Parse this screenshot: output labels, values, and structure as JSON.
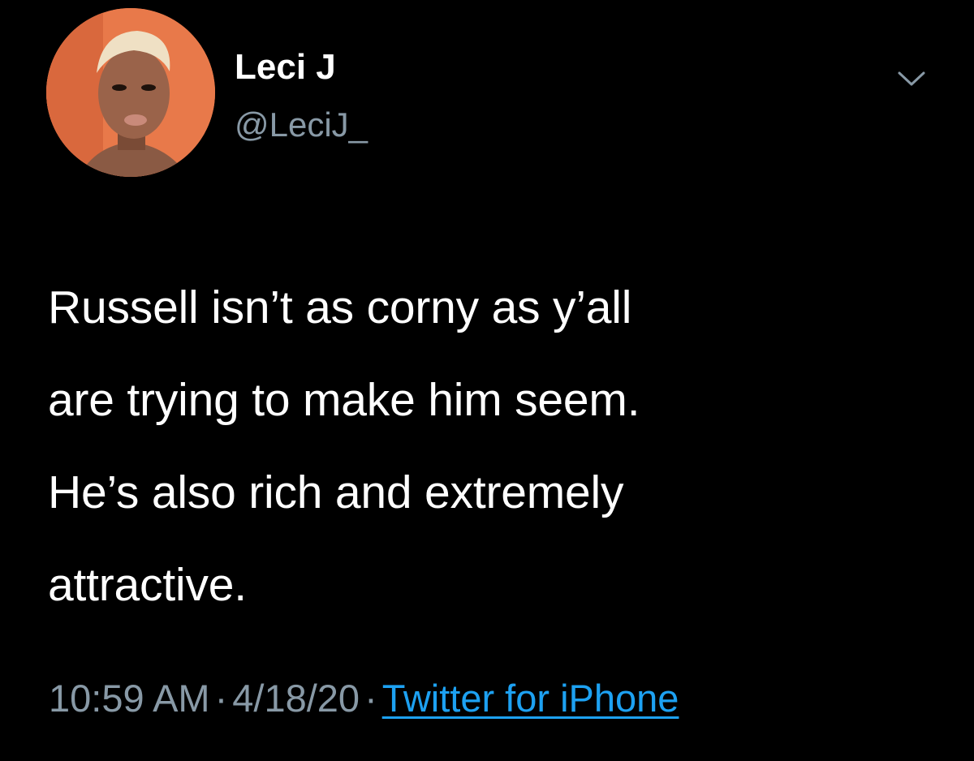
{
  "tweet": {
    "author": {
      "display_name": "Leci J",
      "handle": "@LeciJ_",
      "avatar_icon": "profile-photo"
    },
    "menu_icon": "chevron-down-icon",
    "text_lines": [
      "Russell isn’t as corny as y’all",
      "are trying to make him seem.",
      "He’s also rich and extremely",
      "attractive."
    ],
    "meta": {
      "time": "10:59 AM",
      "separator": "·",
      "date": "4/18/20",
      "source": "Twitter for iPhone"
    }
  },
  "colors": {
    "background": "#000000",
    "text": "#ffffff",
    "secondary": "#8899a6",
    "link": "#1da1f2",
    "avatar_bg": "#e8794a"
  }
}
